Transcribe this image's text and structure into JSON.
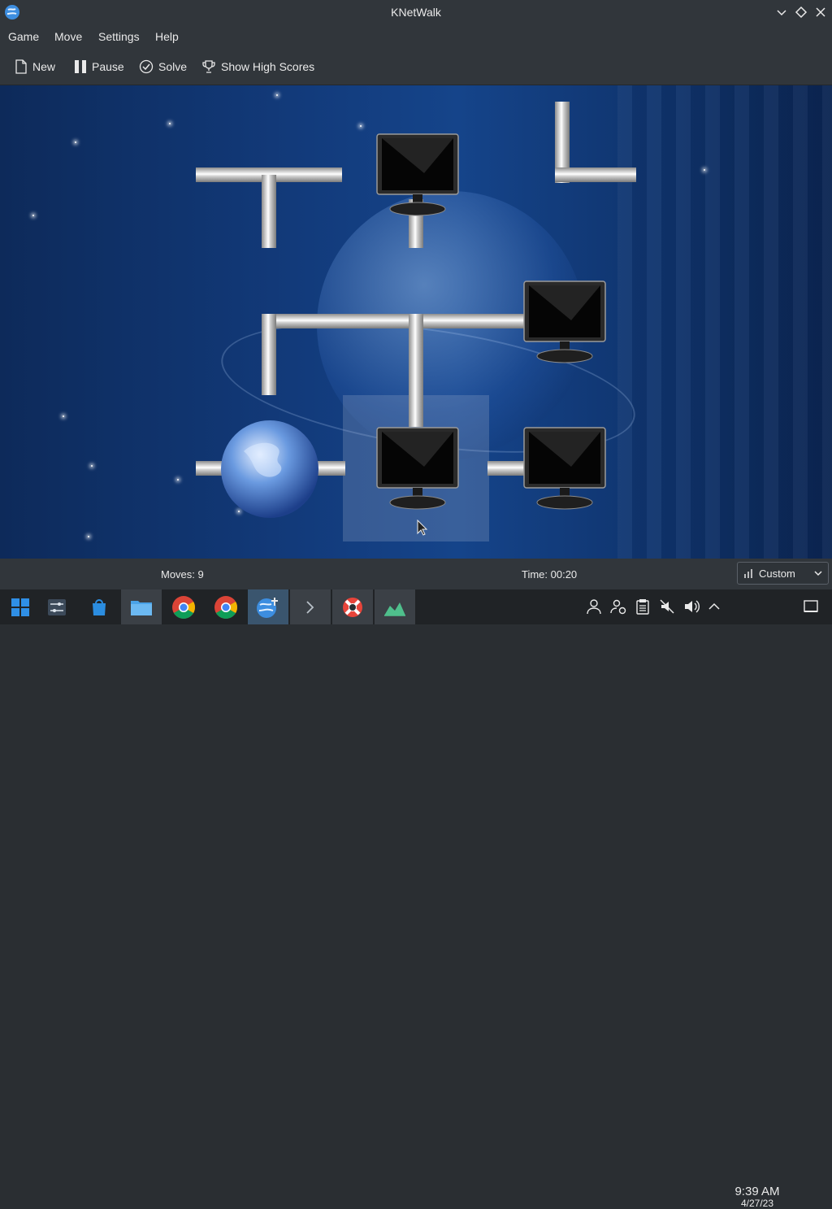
{
  "window": {
    "title": "KNetWalk"
  },
  "menu": [
    "Game",
    "Move",
    "Settings",
    "Help"
  ],
  "toolbar": {
    "new_label": "New",
    "pause_label": "Pause",
    "solve_label": "Solve",
    "highscores_label": "Show High Scores"
  },
  "status": {
    "moves": "Moves: 9",
    "time": "Time: 00:20",
    "difficulty": "Custom"
  },
  "taskbar": {
    "clock_time": "9:39 AM",
    "clock_date": "4/27/23"
  },
  "colors": {
    "chrome": "#31363b",
    "taskbar": "#202326",
    "board_blue": "#123a7a"
  }
}
